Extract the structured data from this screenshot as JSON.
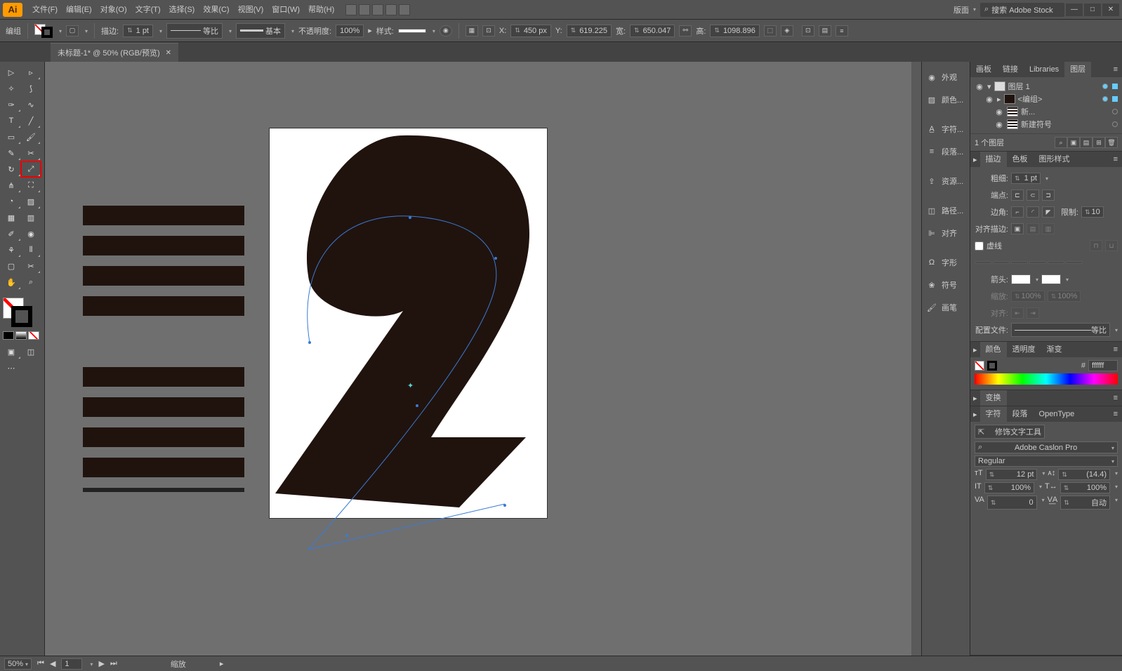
{
  "app": {
    "logo": "Ai"
  },
  "menu": {
    "file": "文件(F)",
    "edit": "编辑(E)",
    "object": "对象(O)",
    "type": "文字(T)",
    "select": "选择(S)",
    "effect": "效果(C)",
    "view": "视图(V)",
    "window": "窗口(W)",
    "help": "帮助(H)"
  },
  "workspace": {
    "label": "版面",
    "search_ph": "搜索 Adobe Stock"
  },
  "ctrl": {
    "mode": "编组",
    "stroke_lbl": "描边:",
    "stroke_w": "1 pt",
    "brush_profile": "等比",
    "brush": "基本",
    "opacity_lbl": "不透明度:",
    "opacity": "100%",
    "style_lbl": "样式:",
    "x_lbl": "X:",
    "x": "450 px",
    "y_lbl": "Y:",
    "y": "619.225",
    "w_lbl": "宽:",
    "w": "650.047",
    "h_lbl": "高:",
    "h": "1098.896"
  },
  "tab": {
    "title": "未标题-1* @ 50% (RGB/预览)"
  },
  "dock": {
    "appearance": "外观",
    "color": "颜色...",
    "char": "字符...",
    "para": "段落...",
    "asset": "资源...",
    "path": "路径...",
    "align": "对齐",
    "glyph": "字形",
    "symbol": "符号",
    "brush": "画笔"
  },
  "layers_panel": {
    "tabs": {
      "artboards": "画板",
      "links": "链接",
      "libraries": "Libraries",
      "layers": "图层"
    },
    "rows": [
      {
        "name": "图层 1",
        "sel": true
      },
      {
        "name": "<编组>",
        "sel": true
      },
      {
        "name": "新...",
        "sel": false
      },
      {
        "name": "新建符号",
        "sel": false
      }
    ],
    "footer": "1 个图层"
  },
  "stroke_panel": {
    "tabs": {
      "stroke": "描边",
      "swatches": "色板",
      "styles": "图形样式"
    },
    "weight_lbl": "粗细:",
    "weight": "1 pt",
    "cap_lbl": "端点:",
    "corner_lbl": "边角:",
    "limit_lbl": "限制:",
    "limit": "10",
    "align_lbl": "对齐描边:",
    "dashed_lbl": "虚线",
    "arrow_lbl": "箭头:",
    "profile_lbl": "配置文件:",
    "profile": "等比"
  },
  "color_panel": {
    "tabs": {
      "color": "颜色",
      "opacity": "透明度",
      "grad": "渐变"
    },
    "hex_lbl": "#",
    "hex": "ffffff"
  },
  "transform_panel": {
    "title": "变换"
  },
  "char_panel": {
    "tabs": {
      "char": "字符",
      "para": "段落",
      "ot": "OpenType"
    },
    "touch": "修饰文字工具",
    "font": "Adobe Caslon Pro",
    "style": "Regular",
    "size": "12 pt",
    "leading": "(14.4)",
    "hscale": "100%",
    "vscale": "100%",
    "kerning": "0",
    "tracking": "自动"
  },
  "status": {
    "zoom": "50%",
    "page": "1",
    "tool": "缩放"
  }
}
